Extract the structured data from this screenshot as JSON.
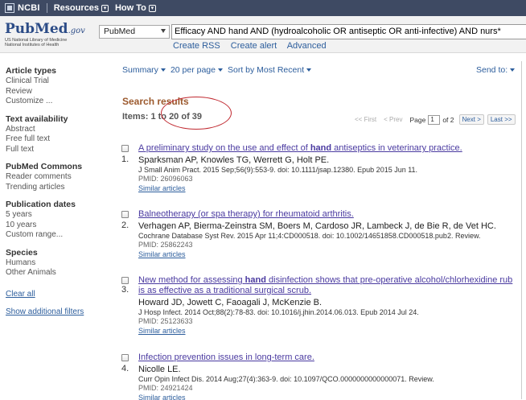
{
  "ncbi": {
    "logo": "NCBI",
    "resources": "Resources",
    "howto": "How To"
  },
  "pubmed": {
    "logo_pub": "Pub",
    "logo_med": "Med",
    "logo_gov": ".gov",
    "sub_line1": "US National Library of Medicine",
    "sub_line2": "National Institutes of Health"
  },
  "search": {
    "database": "PubMed",
    "query": "Efficacy AND hand AND (hydroalcoholic OR antiseptic OR anti-infective) AND nurs*",
    "create_rss": "Create RSS",
    "create_alert": "Create alert",
    "advanced": "Advanced"
  },
  "sidebar": {
    "groups": [
      {
        "title": "Article types",
        "items": [
          "Clinical Trial",
          "Review",
          "Customize ..."
        ]
      },
      {
        "title": "Text availability",
        "items": [
          "Abstract",
          "Free full text",
          "Full text"
        ]
      },
      {
        "title": "PubMed Commons",
        "items": [
          "Reader comments",
          "Trending articles"
        ]
      },
      {
        "title": "Publication dates",
        "items": [
          "5 years",
          "10 years",
          "Custom range..."
        ]
      },
      {
        "title": "Species",
        "items": [
          "Humans",
          "Other Animals"
        ]
      }
    ],
    "clear_all": "Clear all",
    "show_additional": "Show additional filters"
  },
  "display": {
    "format": "Summary",
    "per_page": "20 per page",
    "sort": "Sort by Most Recent",
    "send_to": "Send to:"
  },
  "results": {
    "heading": "Search results",
    "items_label": "Items: 1 to 20 of 39"
  },
  "pager": {
    "first": "<< First",
    "prev": "< Prev",
    "page_label": "Page",
    "page_value": "1",
    "of_pages": "of 2",
    "next": "Next >",
    "last": "Last >>"
  },
  "articles": [
    {
      "num": "1.",
      "title_pre": "A preliminary study on the use and effect of ",
      "title_bold": "hand",
      "title_post": " antiseptics in veterinary practice.",
      "authors": "Sparksman AP, Knowles TG, Werrett G, Holt PE.",
      "cite": "J Small Anim Pract. 2015 Sep;56(9):553-9. doi: 10.1111/jsap.12380. Epub 2015 Jun 11.",
      "pmid": "PMID: 26096063",
      "similar": "Similar articles"
    },
    {
      "num": "2.",
      "title_pre": "Balneotherapy (or spa therapy) for rheumatoid arthritis.",
      "title_bold": "",
      "title_post": "",
      "authors": "Verhagen AP, Bierma-Zeinstra SM, Boers M, Cardoso JR, Lambeck J, de Bie R, de Vet HC.",
      "cite": "Cochrane Database Syst Rev. 2015 Apr 11;4:CD000518. doi: 10.1002/14651858.CD000518.pub2. Review.",
      "pmid": "PMID: 25862243",
      "similar": "Similar articles"
    },
    {
      "num": "3.",
      "title_pre": "New method for assessing ",
      "title_bold": "hand",
      "title_post": " disinfection shows that pre-operative alcohol/chlorhexidine rub is as effective as a traditional surgical scrub.",
      "authors": "Howard JD, Jowett C, Faoagali J, McKenzie B.",
      "cite": "J Hosp Infect. 2014 Oct;88(2):78-83. doi: 10.1016/j.jhin.2014.06.013. Epub 2014 Jul 24.",
      "pmid": "PMID: 25123633",
      "similar": "Similar articles"
    },
    {
      "num": "4.",
      "title_pre": "Infection prevention issues in long-term care.",
      "title_bold": "",
      "title_post": "",
      "authors": "Nicolle LE.",
      "cite": "Curr Opin Infect Dis. 2014 Aug;27(4):363-9. doi: 10.1097/QCO.0000000000000071. Review.",
      "pmid": "PMID: 24921424",
      "similar": "Similar articles"
    }
  ]
}
